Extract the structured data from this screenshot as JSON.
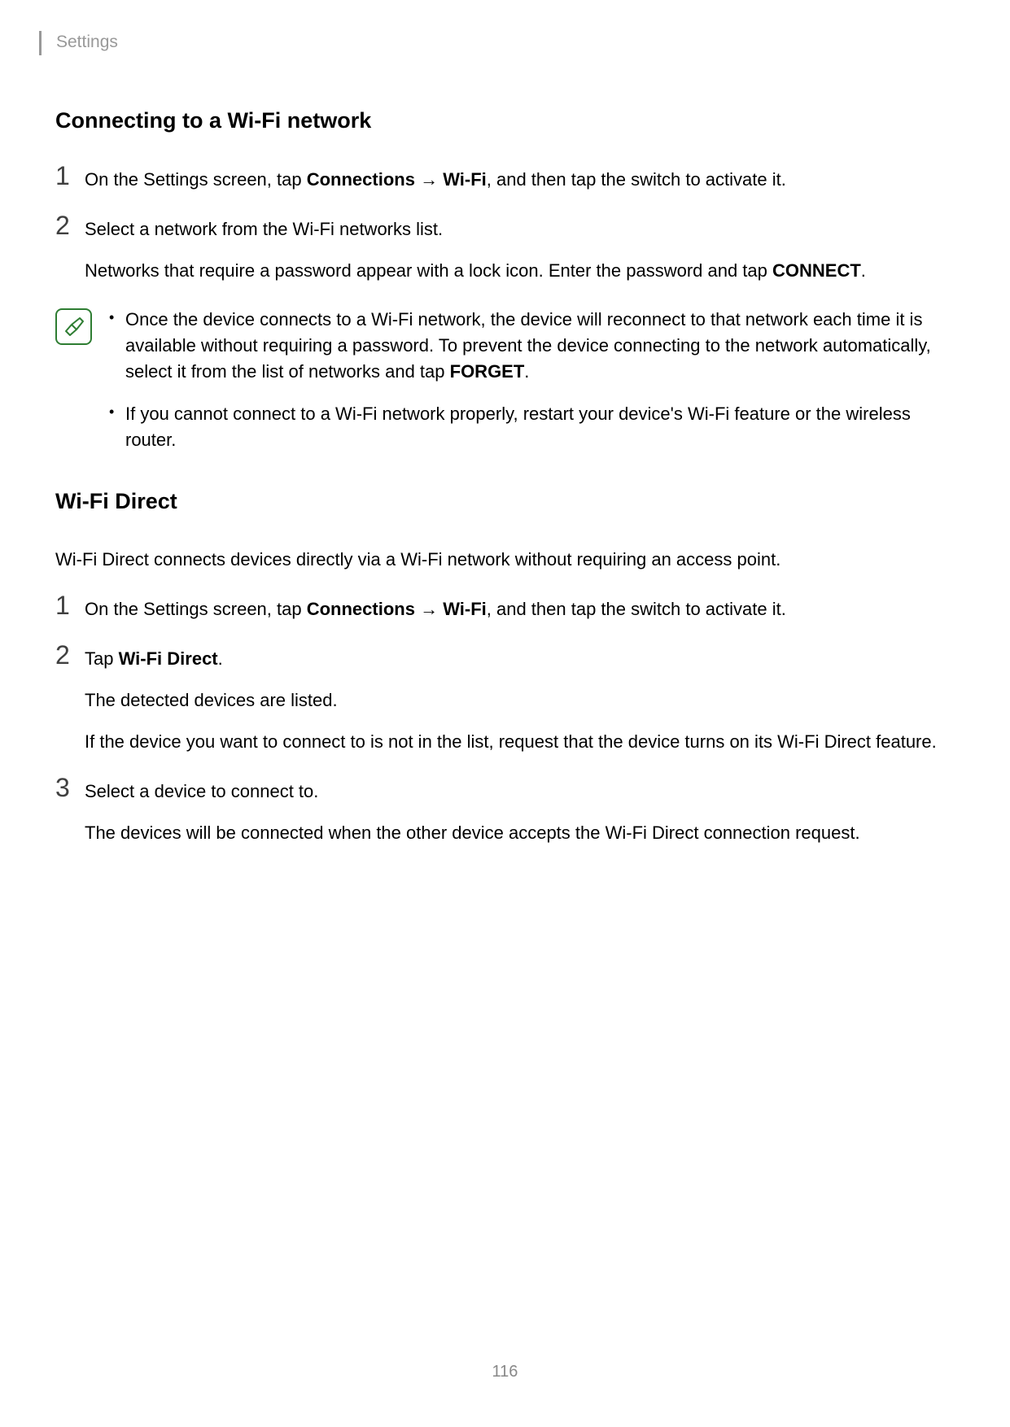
{
  "header": "Settings",
  "section1": {
    "title": "Connecting to a Wi-Fi network",
    "step1": {
      "num": "1",
      "t1": "On the Settings screen, tap ",
      "b1": "Connections",
      "arrow": " → ",
      "b2": "Wi-Fi",
      "t2": ", and then tap the switch to activate it."
    },
    "step2": {
      "num": "2",
      "line1": "Select a network from the Wi-Fi networks list.",
      "line2a": "Networks that require a password appear with a lock icon. Enter the password and tap ",
      "line2b": "CONNECT",
      "line2c": "."
    },
    "note": {
      "bullet1a": "Once the device connects to a Wi-Fi network, the device will reconnect to that network each time it is available without requiring a password. To prevent the device connecting to the network automatically, select it from the list of networks and tap ",
      "bullet1b": "FORGET",
      "bullet1c": ".",
      "bullet2": "If you cannot connect to a Wi-Fi network properly, restart your device's Wi-Fi feature or the wireless router."
    }
  },
  "section2": {
    "title": "Wi-Fi Direct",
    "intro": "Wi-Fi Direct connects devices directly via a Wi-Fi network without requiring an access point.",
    "step1": {
      "num": "1",
      "t1": "On the Settings screen, tap ",
      "b1": "Connections",
      "arrow": " → ",
      "b2": "Wi-Fi",
      "t2": ", and then tap the switch to activate it."
    },
    "step2": {
      "num": "2",
      "line1a": "Tap ",
      "line1b": "Wi-Fi Direct",
      "line1c": ".",
      "line2": "The detected devices are listed.",
      "line3": "If the device you want to connect to is not in the list, request that the device turns on its Wi-Fi Direct feature."
    },
    "step3": {
      "num": "3",
      "line1": "Select a device to connect to.",
      "line2": "The devices will be connected when the other device accepts the Wi-Fi Direct connection request."
    }
  },
  "pageNumber": "116"
}
